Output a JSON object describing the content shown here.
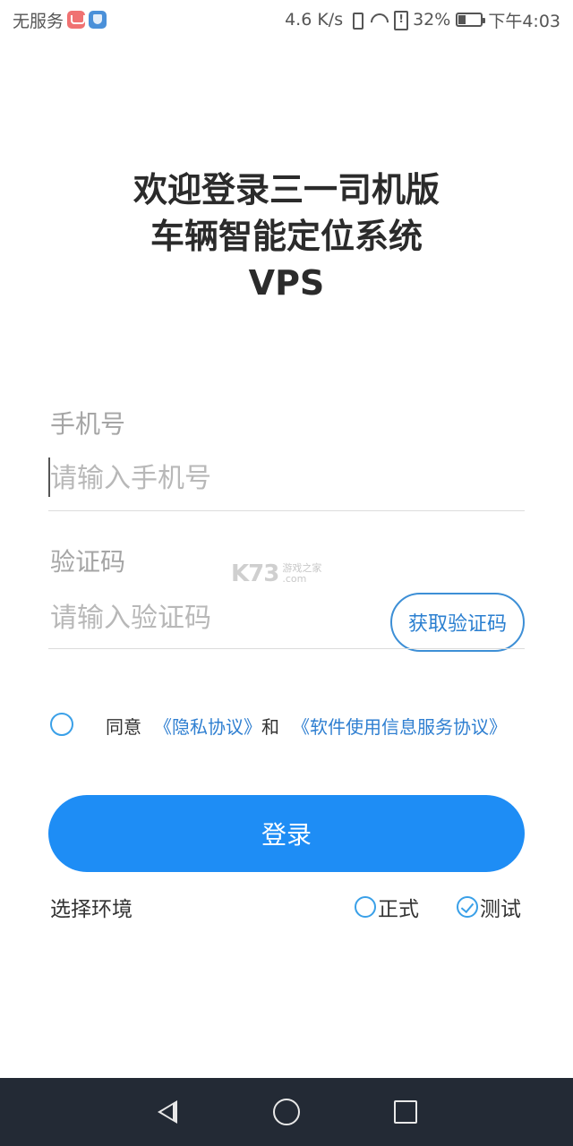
{
  "status_bar": {
    "carrier": "无服务",
    "speed": "4.6 K/s",
    "battery_percent": "32%",
    "battery_level": 0.32,
    "time": "下午4:03",
    "icons": [
      "mail-icon",
      "shield-icon",
      "vibrate-icon",
      "wifi-icon",
      "alert-icon",
      "battery-icon"
    ]
  },
  "title": {
    "line1": "欢迎登录三一司机版",
    "line2": "车辆智能定位系统",
    "line3": "VPS"
  },
  "phone": {
    "label": "手机号",
    "placeholder": "请输入手机号"
  },
  "code": {
    "label": "验证码",
    "placeholder": "请输入验证码",
    "button": "获取验证码"
  },
  "watermark": {
    "brand": "K73",
    "text1": "游戏之家",
    "text2": ".com"
  },
  "agreement": {
    "prefix": "同意",
    "privacy": "《隐私协议》",
    "and": "和",
    "service": "《软件使用信息服务协议》"
  },
  "login": {
    "label": "登录"
  },
  "environment": {
    "label": "选择环境",
    "options": [
      {
        "label": "正式",
        "checked": false
      },
      {
        "label": "测试",
        "checked": true
      }
    ]
  },
  "colors": {
    "accent": "#1e8df5",
    "link": "#2f7fd1",
    "nav_bar": "#232a35"
  }
}
